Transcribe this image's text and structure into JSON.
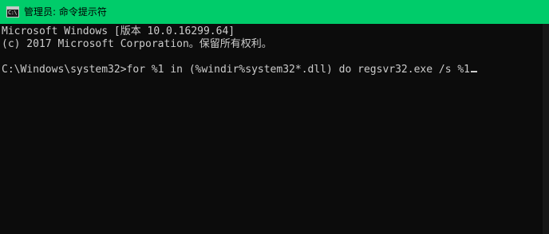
{
  "window": {
    "title": "管理员: 命令提示符",
    "icon": "cmd-icon",
    "icon_text": "C:\\"
  },
  "console": {
    "lines": [
      "Microsoft Windows [版本 10.0.16299.64]",
      "(c) 2017 Microsoft Corporation。保留所有权利。",
      ""
    ],
    "prompt": "C:\\Windows\\system32>",
    "command": "for %1 in (%windir%system32*.dll) do regsvr32.exe /s %1"
  },
  "colors": {
    "titlebar": "#00cc6a",
    "background": "#0c0c0c",
    "text": "#cccccc"
  }
}
